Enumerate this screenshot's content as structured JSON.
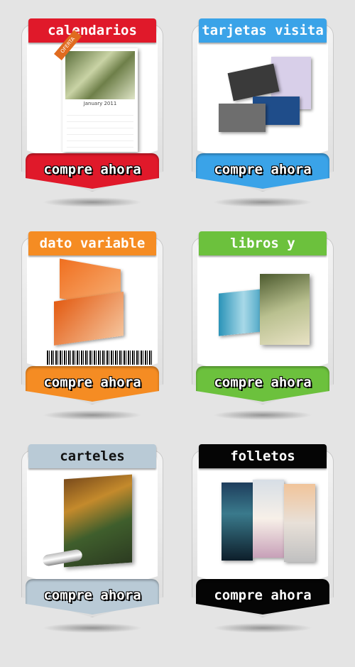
{
  "cards": [
    {
      "title": "calendarios",
      "button": "compre ahora",
      "color": "#e0192a",
      "calendar_month": "January 2011",
      "ribbon": "OFERTA"
    },
    {
      "title": "tarjetas visita",
      "button": "compre ahora",
      "color": "#3aa3e8"
    },
    {
      "title": "dato variable",
      "button": "compre ahora",
      "color": "#f58c23"
    },
    {
      "title": "libros y revistas",
      "button": "compre ahora",
      "color": "#6cc13d"
    },
    {
      "title": "carteles",
      "button": "compre ahora",
      "color": "#b9cad6",
      "text_color": "#111"
    },
    {
      "title": "folletos",
      "button": "compre ahora",
      "color": "#050505"
    }
  ]
}
